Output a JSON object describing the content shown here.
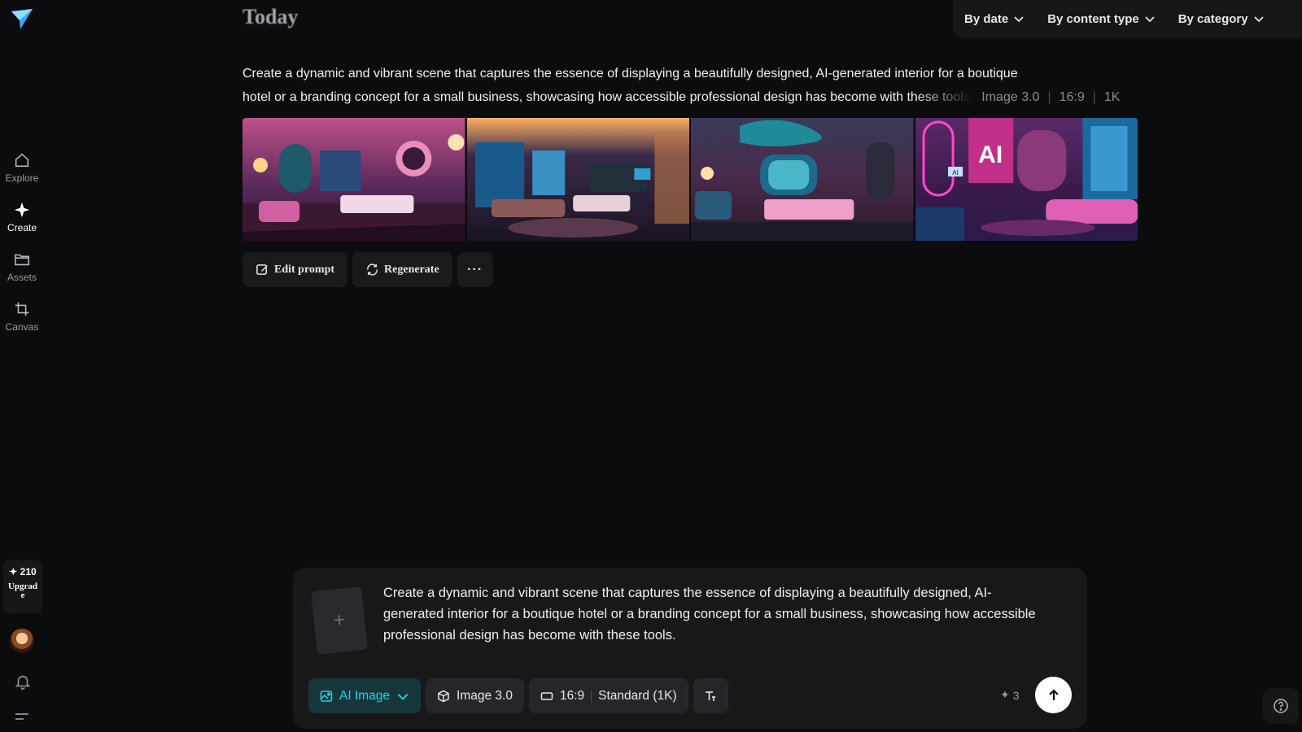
{
  "sidebar": {
    "items": [
      {
        "label": "Explore",
        "icon": "home-icon"
      },
      {
        "label": "Create",
        "icon": "sparkle-icon"
      },
      {
        "label": "Assets",
        "icon": "folder-icon"
      },
      {
        "label": "Canvas",
        "icon": "crop-icon"
      }
    ],
    "credits": "210",
    "upgrade_label": "Upgrade"
  },
  "header": {
    "section_title": "Today",
    "filters": [
      "By date",
      "By content type",
      "By category"
    ]
  },
  "generation": {
    "prompt_line1": "Create a dynamic and vibrant scene that captures the essence of displaying a beautifully designed, AI-generated interior for a boutique",
    "prompt_line2": "hotel or a branding concept for a small business, showcasing how accessible professional design has become with these tools.",
    "model": "Image 3.0",
    "ratio": "16:9",
    "resolution": "1K",
    "actions": {
      "edit": "Edit prompt",
      "regenerate": "Regenerate",
      "more": "···"
    },
    "image_signs": [
      "AI",
      "AI"
    ]
  },
  "composer": {
    "text": "Create a dynamic and vibrant scene that captures the essence of displaying a beautifully designed, AI-generated interior for a boutique hotel or a branding concept for a small business, showcasing how accessible professional design has become with these tools.",
    "mode": "AI Image",
    "model": "Image 3.0",
    "ratio": "16:9",
    "quality": "Standard (1K)",
    "cost": "3"
  },
  "colors": {
    "accent": "#1fd1e6",
    "background": "#0c0c0e",
    "panel": "#18181b"
  }
}
